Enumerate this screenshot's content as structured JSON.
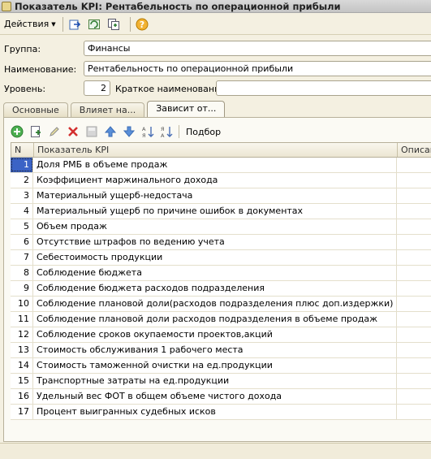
{
  "window": {
    "title": "Показатель KPI: Рентабельность по операционной прибыли"
  },
  "toolbar": {
    "actions_label": "Действия",
    "icons": [
      "record-icon",
      "refresh-icon",
      "copy-icon",
      "help-icon"
    ]
  },
  "form": {
    "group_label": "Группа:",
    "group_value": "Финансы",
    "name_label": "Наименование:",
    "name_value": "Рентабельность по операционной прибыли",
    "level_label": "Уровень:",
    "level_value": "2",
    "short_name_label": "Краткое наименование:",
    "short_name_value": ""
  },
  "tabs": [
    {
      "label": "Основные"
    },
    {
      "label": "Влияет на..."
    },
    {
      "label": "Зависит от..."
    }
  ],
  "panel_toolbar": {
    "selection_label": "Подбор"
  },
  "table": {
    "columns": [
      "N",
      "Показатель KPI",
      "Описан"
    ],
    "rows": [
      {
        "n": "1",
        "kpi": "Доля РМБ в объеме продаж"
      },
      {
        "n": "2",
        "kpi": "Коэффициент маржинального дохода"
      },
      {
        "n": "3",
        "kpi": "Материальный ущерб-недостача"
      },
      {
        "n": "4",
        "kpi": "Материальный ущерб по причине ошибок в документах"
      },
      {
        "n": "5",
        "kpi": "Объем продаж"
      },
      {
        "n": "6",
        "kpi": "Отсутствие штрафов по ведению учета"
      },
      {
        "n": "7",
        "kpi": "Себестоимость продукции"
      },
      {
        "n": "8",
        "kpi": "Соблюдение бюджета"
      },
      {
        "n": "9",
        "kpi": "Соблюдение бюджета расходов подразделения"
      },
      {
        "n": "10",
        "kpi": "Соблюдение плановой доли(расходов подразделения плюс доп.издержки) в объеме..."
      },
      {
        "n": "11",
        "kpi": "Соблюдение плановой доли расходов подразделения в объеме продаж"
      },
      {
        "n": "12",
        "kpi": "Соблюдение сроков окупаемости проектов,акций"
      },
      {
        "n": "13",
        "kpi": "Стоимость обслуживания 1 рабочего места"
      },
      {
        "n": "14",
        "kpi": "Стоимость таможенной очистки на ед.продукции"
      },
      {
        "n": "15",
        "kpi": "Транспортные затраты на ед.продукции"
      },
      {
        "n": "16",
        "kpi": "Удельный вес ФОТ в общем объеме чистого дохода"
      },
      {
        "n": "17",
        "kpi": "Процент выигранных судебных исков"
      }
    ]
  }
}
